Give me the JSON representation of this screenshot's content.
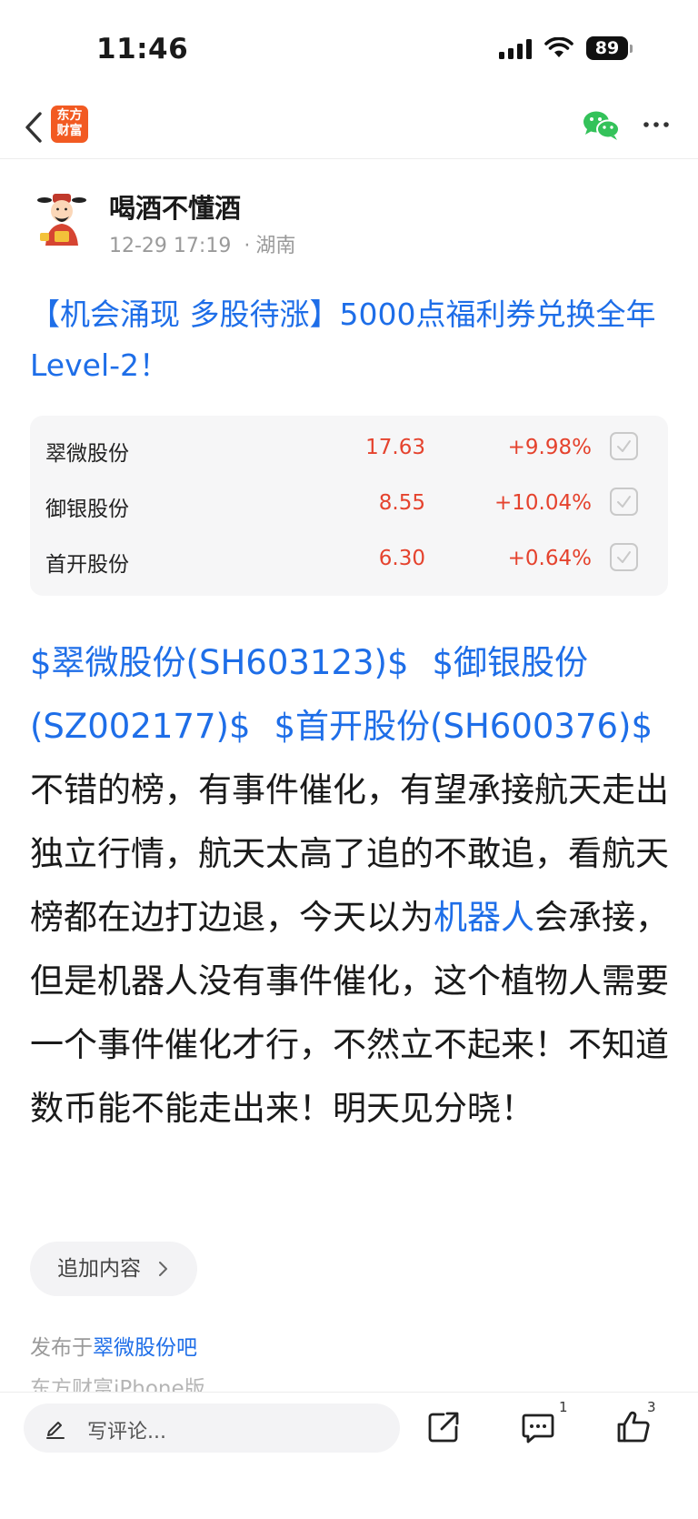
{
  "status": {
    "time": "11:46",
    "battery": "89"
  },
  "nav": {
    "brand_line1": "东方",
    "brand_line2": "财富"
  },
  "author": {
    "name": "喝酒不懂酒",
    "date": "12-29 17:19",
    "location": "湖南"
  },
  "post": {
    "title": "【机会涌现 多股待涨】5000点福利券兑换全年Level-2！",
    "stocks": [
      {
        "name": "翠微股份",
        "price": "17.63",
        "change": "+9.98%"
      },
      {
        "name": "御银股份",
        "price": "8.55",
        "change": "+10.04%"
      },
      {
        "name": "首开股份",
        "price": "6.30",
        "change": "+0.64%"
      }
    ],
    "tags": [
      "$翠微股份(SH603123)$",
      "$御银股份(SZ002177)$",
      "$首开股份(SH600376)$"
    ],
    "body_part1": "不错的榜，有事件催化，有望承接航天走出独立行情，航天太高了追的不敢追，看航天榜都在边打边退，今天以为",
    "body_link": "机器人",
    "body_part2": "会承接，但是机器人没有事件催化，这个植物人需要一个事件催化才行，不然立不起来！不知道数币能不能走出来！明天见分晓！",
    "append_label": "追加内容",
    "posted_in_prefix": "发布于",
    "posted_in_bar": "翠微股份吧",
    "client": "东方财富iPhone版"
  },
  "bottom": {
    "comment_placeholder": "写评论...",
    "comment_count": "1",
    "like_count": "3"
  },
  "colors": {
    "link": "#1e6ee8",
    "up": "#e5432e",
    "brand": "#f25a22",
    "wechat": "#34c25a"
  }
}
